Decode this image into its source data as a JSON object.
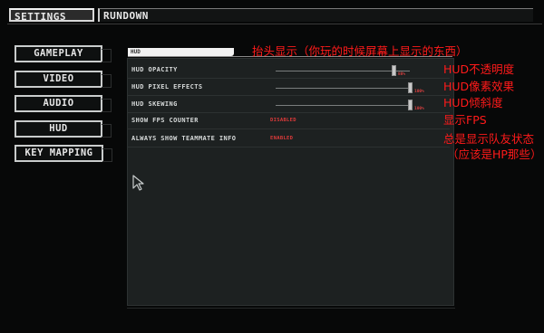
{
  "top_tabs": {
    "settings": "SETTINGS",
    "rundown": "RUNDOWN"
  },
  "menu": {
    "items": [
      {
        "label": "GAMEPLAY"
      },
      {
        "label": "VIDEO"
      },
      {
        "label": "AUDIO"
      },
      {
        "label": "HUD"
      },
      {
        "label": "KEY MAPPING"
      }
    ]
  },
  "hud_panel": {
    "header": "HUD",
    "rows": [
      {
        "label": "HUD OPACITY",
        "value": "88%",
        "level": 0.88
      },
      {
        "label": "HUD PIXEL EFFECTS",
        "value": "100%",
        "level": 1.0
      },
      {
        "label": "HUD SKEWING",
        "value": "100%",
        "level": 1.0
      },
      {
        "label": "SHOW FPS COUNTER",
        "value": "DISABLED"
      },
      {
        "label": "ALWAYS SHOW TEAMMATE INFO",
        "value": "ENABLED"
      }
    ]
  },
  "annotations": {
    "header_note": "抬头显示（你玩的时候屏幕上显示的东西）",
    "opacity_note": "HUD不透明度",
    "pixel_note": "HUD像素效果",
    "skew_note": "HUD倾斜度",
    "fps_note": "显示FPS",
    "teammate_note_1": "总是显示队友状态",
    "teammate_note_2": "（应该是HP那些）"
  },
  "colors": {
    "annotation": "#ff1a1a",
    "value_red": "#dc3a3a",
    "panel": "#1d2121"
  },
  "icons": {
    "cursor": "mouse-pointer-icon"
  }
}
